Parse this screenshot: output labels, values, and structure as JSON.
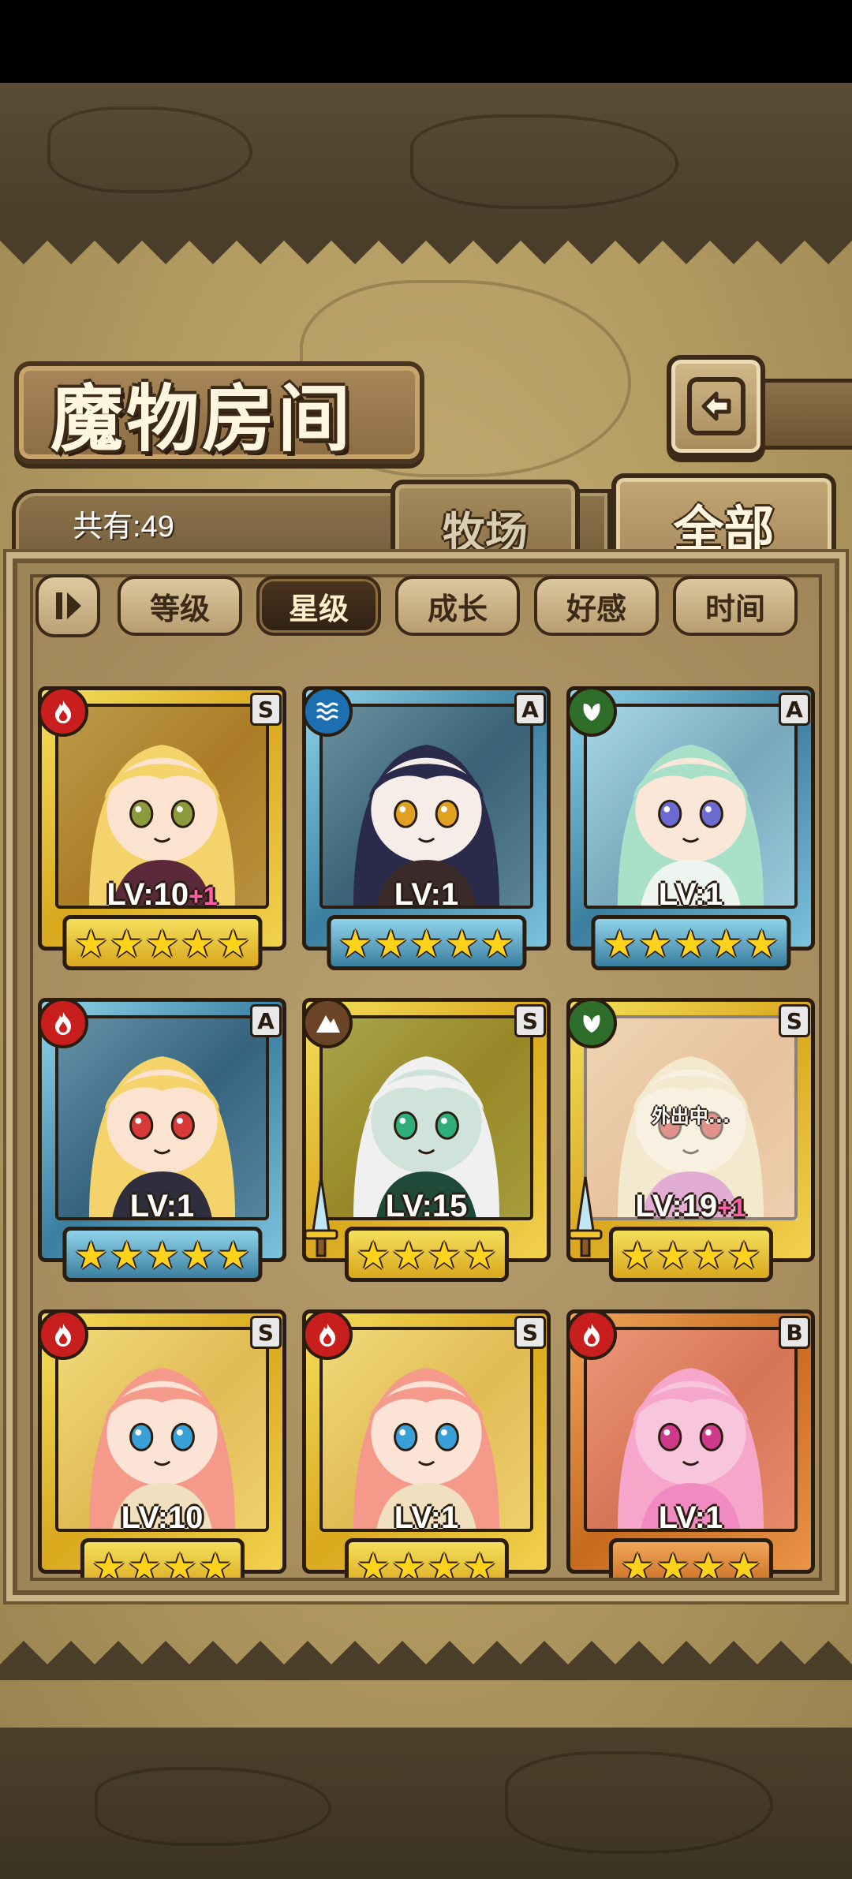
{
  "header": {
    "title": "魔物房间",
    "back_icon": "return-arrow-icon"
  },
  "summary": {
    "count_label": "共有:49"
  },
  "tabs": [
    {
      "label": "牧场",
      "active": false
    },
    {
      "label": "全部",
      "active": true
    }
  ],
  "sort": {
    "toggle_icon": "sort-order-icon",
    "buttons": [
      {
        "label": "等级",
        "active": false
      },
      {
        "label": "星级",
        "active": true
      },
      {
        "label": "成长",
        "active": false
      },
      {
        "label": "好感",
        "active": false
      },
      {
        "label": "时间",
        "active": false
      }
    ]
  },
  "monsters": [
    {
      "element": "fire",
      "rank": "S",
      "level": "LV:10",
      "bonus": "+1",
      "stars": 5,
      "hair": "#f3d36a",
      "skin": "#fbe3cf",
      "outfit": "#5a2a3a",
      "eye": "#8b9a3a"
    },
    {
      "element": "water",
      "rank": "A",
      "level": "LV:1",
      "bonus": "",
      "stars": 5,
      "hair": "#2a2a4a",
      "skin": "#f6ede8",
      "outfit": "#3a2a2a",
      "eye": "#e0a020"
    },
    {
      "element": "leaf",
      "rank": "A",
      "level": "LV:1",
      "bonus": "",
      "stars": 5,
      "hair": "#a8e0c8",
      "skin": "#fbe7d8",
      "outfit": "#eef4f0",
      "eye": "#6a6ad0"
    },
    {
      "element": "fire",
      "rank": "A",
      "level": "LV:1",
      "bonus": "",
      "stars": 5,
      "hair": "#f3d36a",
      "skin": "#fbe3cf",
      "outfit": "#2e2e3e",
      "eye": "#d83a3a"
    },
    {
      "element": "earth",
      "rank": "S",
      "level": "LV:15",
      "bonus": "",
      "stars": 4,
      "hair": "#f0f0f0",
      "skin": "#cfe3da",
      "outfit": "#1f4a3a",
      "eye": "#2fae7a",
      "weapon": true
    },
    {
      "element": "leaf",
      "rank": "S",
      "level": "LV:19",
      "bonus": "+1",
      "stars": 4,
      "hair": "#e9d7a8",
      "skin": "#f3e3c8",
      "outfit": "#c86ab0",
      "eye": "#c83a2a",
      "weapon": true,
      "away": "外出中..."
    },
    {
      "element": "fire",
      "rank": "S",
      "level": "LV:10",
      "bonus": "",
      "stars": 4,
      "hair": "#f59a8a",
      "skin": "#fbe3d6",
      "outfit": "#f0e0c0",
      "eye": "#3aa0d8"
    },
    {
      "element": "fire",
      "rank": "S",
      "level": "LV:1",
      "bonus": "",
      "stars": 4,
      "hair": "#f59a8a",
      "skin": "#fbe3d6",
      "outfit": "#f0e0c0",
      "eye": "#3aa0d8"
    },
    {
      "element": "fire",
      "rank": "B",
      "level": "LV:1",
      "bonus": "",
      "stars": 4,
      "hair": "#f6a6c8",
      "skin": "#f7c6dc",
      "outfit": "#f08ac0",
      "eye": "#d03a8a"
    }
  ],
  "colors": {
    "parchment": "#b39b61",
    "frame_dark": "#3b2a17",
    "gold_frame": "#d9a81d",
    "blue_frame": "#3b7fa0",
    "orange_frame": "#c76a1e",
    "star": "#ffd21c",
    "bonus": "#ff5ea8"
  }
}
